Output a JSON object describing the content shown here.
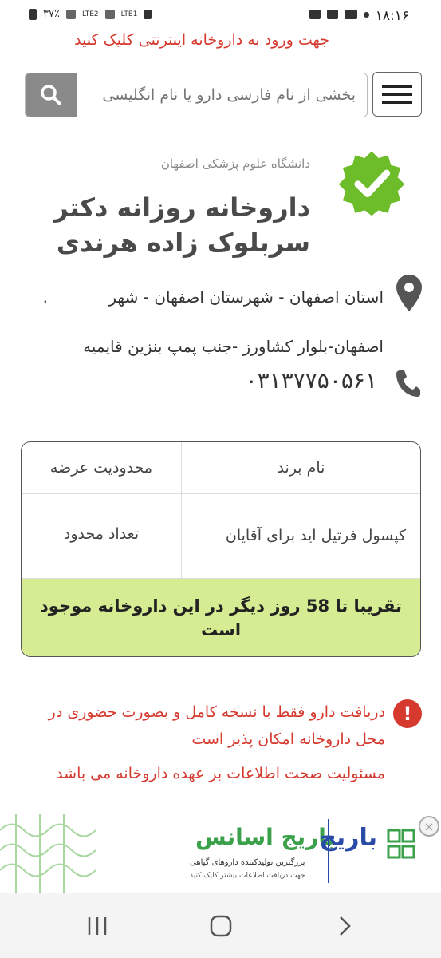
{
  "statusbar": {
    "time": "۱۸:۱۶",
    "battery": "۳۷٪",
    "network1": "LTE2",
    "network2": "LTE1"
  },
  "banner": {
    "text": "جهت ورود به داروخانه اینترنتی کلیک کنید"
  },
  "search": {
    "placeholder": "بخشی از نام فارسی دارو یا نام انگلیسی"
  },
  "pharmacy": {
    "university": "دانشگاه علوم پزشکی اصفهان",
    "name": "داروخانه روزانه دکتر سربلوک زاده هرندی",
    "address_line1": "استان اصفهان - شهرستان اصفهان - شهر",
    "address_dot": ".",
    "address_line2": "اصفهان-بلوار کشاورز -جنب پمپ بنزین قایمیه",
    "phone": "۰۳۱۳۷۷۵۰۵۶۱"
  },
  "table": {
    "col_brand": "نام برند",
    "col_limit": "محدودیت عرضه",
    "brand_value": "کپسول فرتیل اید برای آقایان",
    "limit_value": "تعداد محدود",
    "availability": "تقریبا تا 58 روز دیگر در این داروخانه موجود است"
  },
  "notice": {
    "warning": "دریافت دارو فقط با نسخه کامل و بصورت حضوری در محل داروخانه امکان پذیر است",
    "responsibility": "مسئولیت صحت اطلاعات بر عهده داروخانه می باشد"
  },
  "ad": {
    "brand1": "باریج",
    "brand2": "باریج اسانس",
    "brand2_sub": "بزرگترین تولیدکننده داروهای گیاهی",
    "brand2_sub2": "جهت دریافت اطلاعات بیشتر کلیک کنید"
  },
  "colors": {
    "accent_red": "#d63a2f",
    "badge_green": "#6dbd2a",
    "availability_bg": "#d5ec93"
  }
}
